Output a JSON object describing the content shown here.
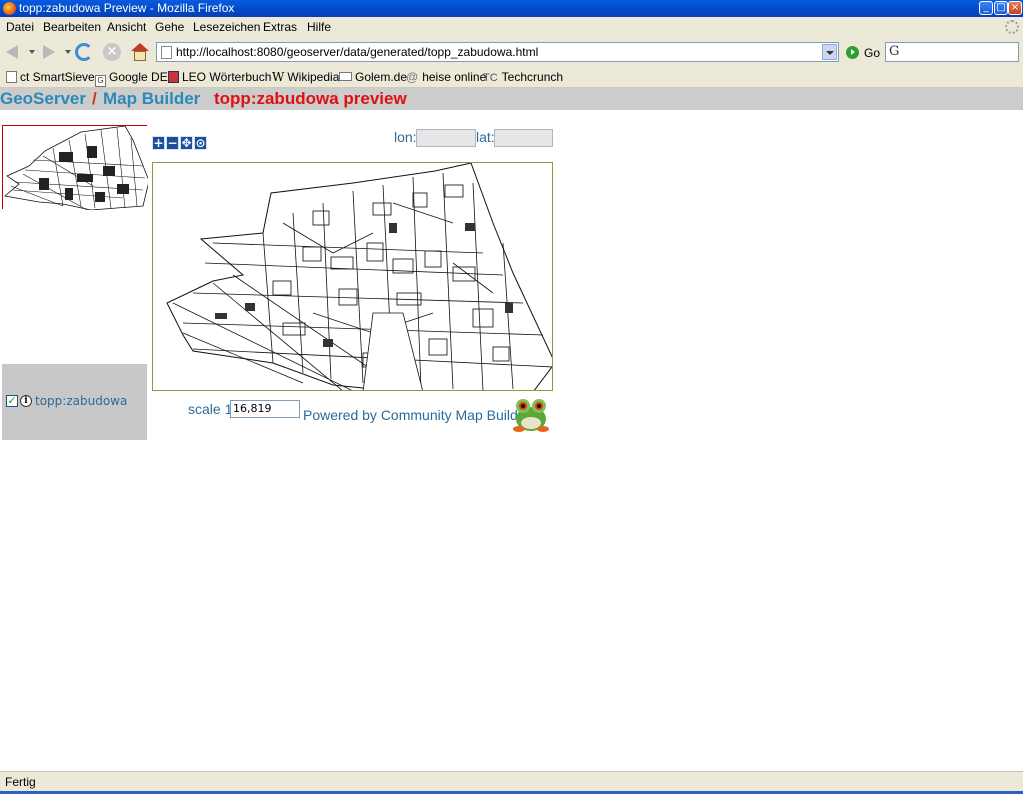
{
  "window": {
    "title": "topp:zabudowa Preview - Mozilla Firefox",
    "buttons": {
      "minimize": "_",
      "maximize": "□",
      "close": "×"
    }
  },
  "menu": [
    "Datei",
    "Bearbeiten",
    "Ansicht",
    "Gehe",
    "Lesezeichen",
    "Extras",
    "Hilfe"
  ],
  "navbar": {
    "url": "http://localhost:8080/geoserver/data/generated/topp_zabudowa.html",
    "go_label": "Go",
    "search_engine_glyph": "G",
    "icons": [
      "back-icon",
      "forward-icon",
      "reload-icon",
      "stop-icon",
      "home-icon"
    ]
  },
  "bookmarks": [
    {
      "label": "ct SmartSieve",
      "icon": "📄"
    },
    {
      "label": "Google DE",
      "icon": "G"
    },
    {
      "label": "LEO Wörterbuch",
      "icon": "🇬🇧"
    },
    {
      "label": "Wikipedia",
      "icon": "W"
    },
    {
      "label": "Golem.de",
      "icon": "▭"
    },
    {
      "label": "heise online",
      "icon": "@"
    },
    {
      "label": "Techcrunch",
      "icon": "TC"
    }
  ],
  "page": {
    "header": {
      "geoserver": "GeoServer",
      "slash": "/",
      "map_builder": "Map Builder",
      "preview": "topp:zabudowa preview"
    },
    "tools": [
      "+",
      "−",
      "✥",
      "⊙"
    ],
    "coords": {
      "lon_label": "lon:",
      "lon_value": "",
      "lat_label": "lat:",
      "lat_value": ""
    },
    "legend": {
      "layer_name": "topp:zabudowa",
      "checked": true
    },
    "scale": {
      "label": "scale 1:",
      "value": "16,819"
    },
    "powered_by": "Powered by Community Map Builder"
  },
  "status": {
    "text": "Fertig"
  },
  "colors": {
    "header_blue": "#2a8ab8",
    "header_red": "#e01010",
    "map_border": "#8a9a3a",
    "link_blue": "#2a6b9a"
  }
}
